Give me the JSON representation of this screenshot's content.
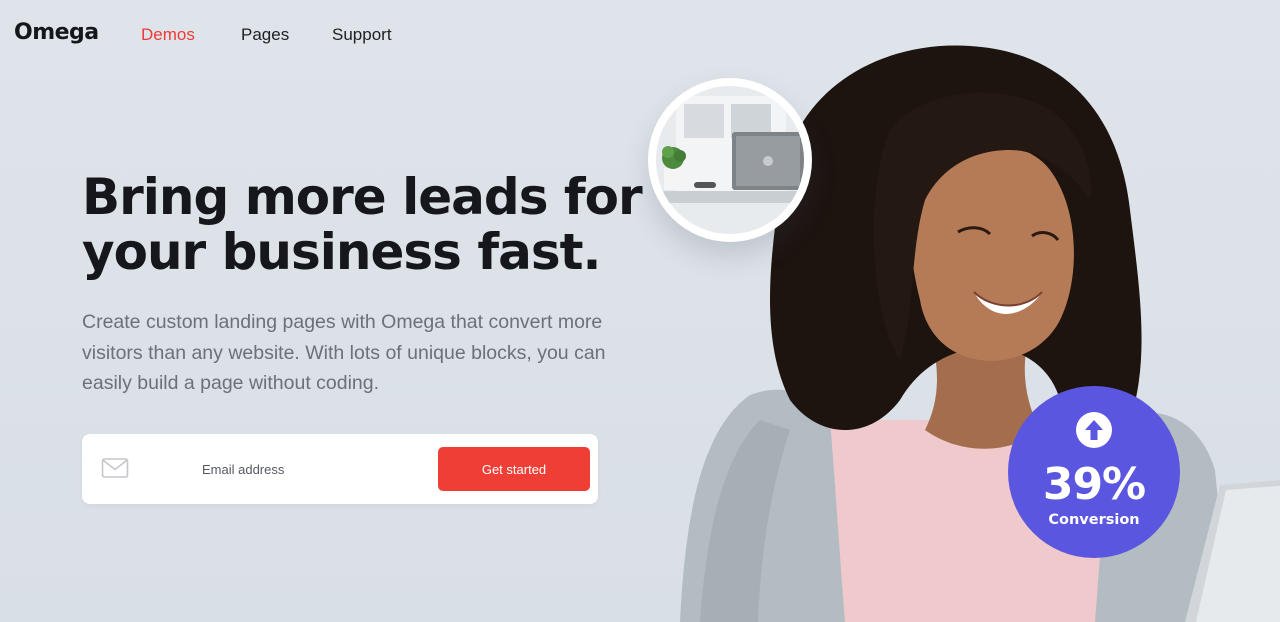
{
  "nav": {
    "logo": "Omega",
    "links": [
      {
        "label": "Demos",
        "active": true
      },
      {
        "label": "Pages",
        "active": false
      },
      {
        "label": "Support",
        "active": false
      }
    ]
  },
  "hero": {
    "headline_line1": "Bring more leads for",
    "headline_line2": "your business fast.",
    "description": "Create custom landing pages with Omega that convert more visitors than any website. With lots of unique blocks, you can easily build a page without coding."
  },
  "form": {
    "email_placeholder": "Email address",
    "email_value": "",
    "submit_label": "Get started",
    "icon": "mail-icon"
  },
  "badge": {
    "value": "39%",
    "label": "Conversion",
    "icon": "arrow-up-icon"
  },
  "colors": {
    "accent": "#ee3b35",
    "button": "#ef3e36",
    "badge": "#5b56df",
    "background": "#dde2e8",
    "text_dark": "#15171c",
    "text_muted": "#6c7079"
  }
}
